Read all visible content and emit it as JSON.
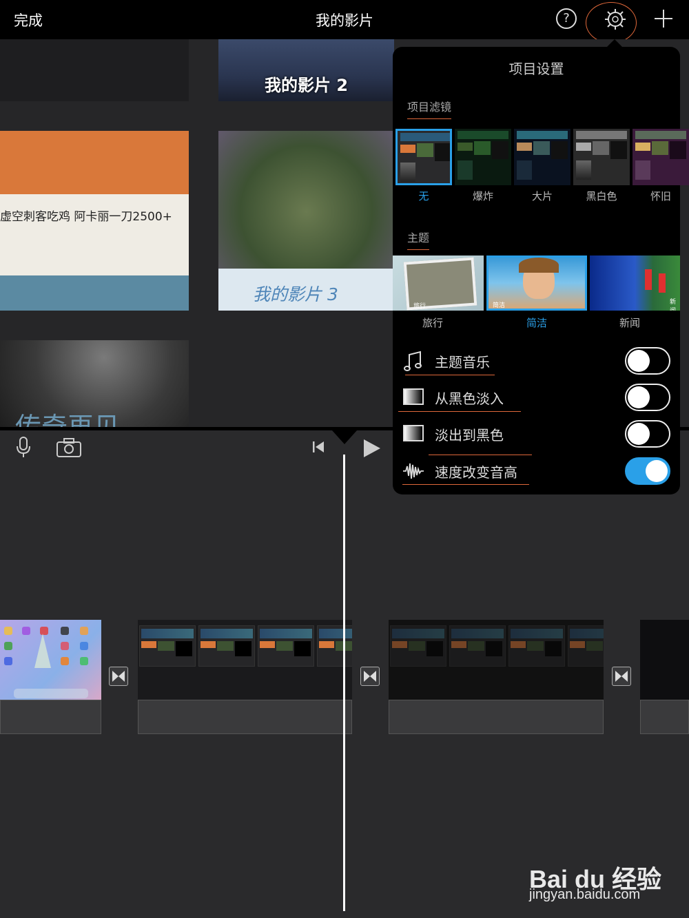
{
  "header": {
    "done_label": "完成",
    "title": "我的影片",
    "help_label": "?"
  },
  "projects": [
    {
      "label": ""
    },
    {
      "label": "我的影片 2"
    },
    {
      "label": "虚空刺客吃鸡 阿卡丽一刀2500+"
    },
    {
      "label": "我的影片 3"
    },
    {
      "label": "传奇再见"
    }
  ],
  "settings_panel": {
    "title": "项目设置",
    "filters_heading": "项目滤镜",
    "filters": [
      {
        "label": "无",
        "selected": true
      },
      {
        "label": "爆炸",
        "selected": false
      },
      {
        "label": "大片",
        "selected": false
      },
      {
        "label": "黑白色",
        "selected": false
      },
      {
        "label": "怀旧",
        "selected": false
      }
    ],
    "themes_heading": "主题",
    "themes": [
      {
        "label": "旅行",
        "caption": "旅行",
        "selected": false
      },
      {
        "label": "简洁",
        "caption": "简洁",
        "selected": true
      },
      {
        "label": "新闻",
        "caption": "新闻",
        "selected": false
      }
    ],
    "toggles": [
      {
        "label": "主题音乐",
        "icon": "music-note-icon",
        "on": false
      },
      {
        "label": "从黑色淡入",
        "icon": "fade-in-icon",
        "on": false
      },
      {
        "label": "淡出到黑色",
        "icon": "fade-out-icon",
        "on": false
      },
      {
        "label": "速度改变音高",
        "icon": "waveform-icon",
        "on": true
      }
    ]
  },
  "watermark": {
    "brand": "Bai du 经验",
    "url": "jingyan.baidu.com"
  },
  "colors": {
    "accent": "#2aa0e8",
    "highlight": "#e0683a",
    "background": "#2a2a2c"
  }
}
